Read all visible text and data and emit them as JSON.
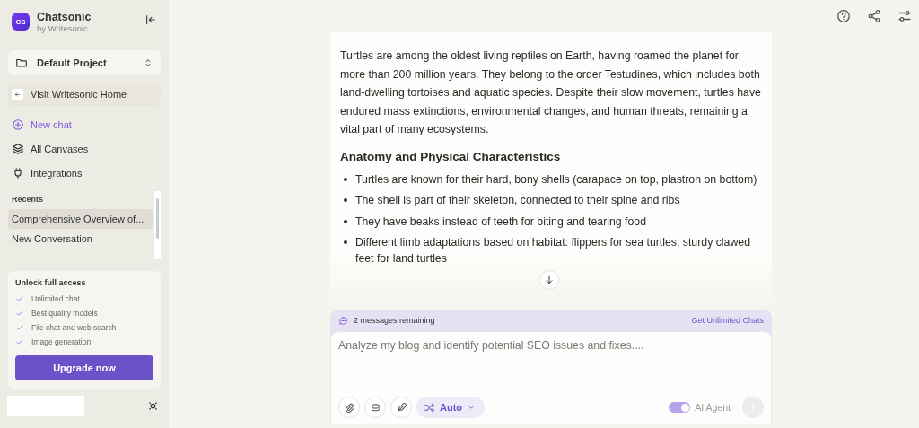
{
  "sidebar": {
    "brand": {
      "logo": "CS",
      "name": "Chatsonic",
      "subtitle": "by Writesonic"
    },
    "project": "Default Project",
    "home_link": "Visit Writesonic Home",
    "nav": [
      {
        "kind": "new",
        "label": "New chat"
      },
      {
        "kind": "canvases",
        "label": "All Canvases"
      },
      {
        "kind": "integrations",
        "label": "Integrations"
      }
    ],
    "recents_title": "Recents",
    "recents": [
      {
        "title": "Comprehensive Overview of...",
        "selected": true
      },
      {
        "title": "New Conversation",
        "selected": false
      }
    ],
    "upgrade": {
      "title": "Unlock full access",
      "features": [
        "Unlimited chat",
        "Best quality models",
        "File chat and web search",
        "Image generation"
      ],
      "button": "Upgrade now"
    }
  },
  "chat": {
    "intro": "Turtles are among the oldest living reptiles on Earth, having roamed the planet for more than 200 million years. They belong to the order Testudines, which includes both land-dwelling tortoises and aquatic species. Despite their slow movement, turtles have endured mass extinctions, environmental changes, and human threats, remaining a vital part of many ecosystems.",
    "heading": "Anatomy and Physical Characteristics",
    "bullets": [
      "Turtles are known for their hard, bony shells (carapace on top, plastron on bottom)",
      "The shell is part of their skeleton, connected to their spine and ribs",
      "They have beaks instead of teeth for biting and tearing food",
      "Different limb adaptations based on habitat: flippers for sea turtles, sturdy clawed feet for land turtles"
    ]
  },
  "composer": {
    "remaining": "2 messages remaining",
    "upsell": "Get Unlimited Chats",
    "placeholder": "Analyze my blog and identify potential SEO issues and fixes....",
    "model": "Auto",
    "agent_label": "AI Agent",
    "agent_on": true
  }
}
